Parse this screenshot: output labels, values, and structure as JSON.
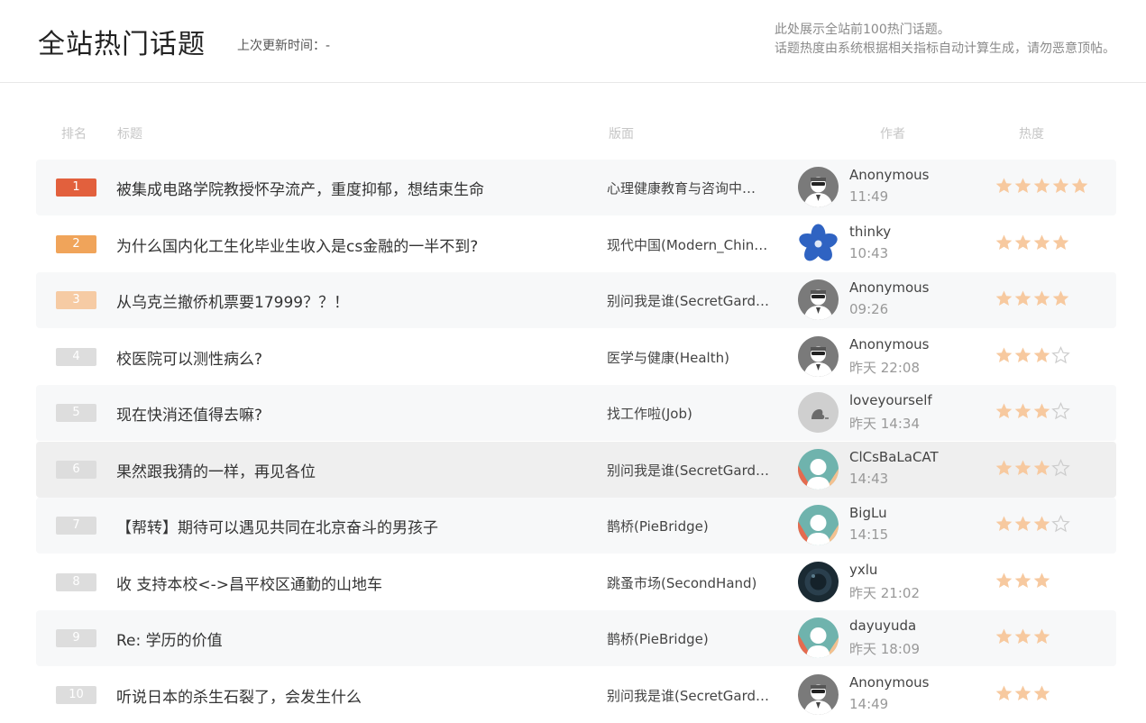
{
  "header": {
    "title": "全站热门话题",
    "updated": "上次更新时间：-",
    "notice_line1": "此处展示全站前100热门话题。",
    "notice_line2": "话题热度由系统根据相关指标自动计算生成，请勿恶意顶帖。"
  },
  "columns": {
    "rank": "排名",
    "title": "标题",
    "board": "版面",
    "author": "作者",
    "heat": "热度"
  },
  "colors": {
    "rank1": "#e2603d",
    "rank2": "#f0a45a",
    "rank3": "#f6cba4",
    "rank_default": "#dddddd",
    "star_filled": "#f7c99f",
    "star_empty": "#cccccc"
  },
  "topics": [
    {
      "rank": "1",
      "title": "被集成电路学院教授怀孕流产，重度抑郁，想结束生命",
      "board": "心理健康教育与咨询中…",
      "author": "Anonymous",
      "time": "11:49",
      "stars": 5,
      "max_stars": 5,
      "avatar": "anonymous-avatar"
    },
    {
      "rank": "2",
      "title": "为什么国内化工生化毕业生收入是cs金融的一半不到?",
      "board": "现代中国(Modern_Chin…",
      "author": "thinky",
      "time": "10:43",
      "stars": 4,
      "max_stars": 4,
      "avatar": "blue-flower-avatar"
    },
    {
      "rank": "3",
      "title": "从乌克兰撤侨机票要17999？？！",
      "board": "别问我是谁(SecretGard…",
      "author": "Anonymous",
      "time": "09:26",
      "stars": 4,
      "max_stars": 4,
      "avatar": "anonymous-avatar"
    },
    {
      "rank": "4",
      "title": "校医院可以测性病么?",
      "board": "医学与健康(Health)",
      "author": "Anonymous",
      "time": "昨天 22:08",
      "stars": 3,
      "max_stars": 4,
      "avatar": "anonymous-avatar"
    },
    {
      "rank": "5",
      "title": "现在快消还值得去嘛?",
      "board": "找工作啦(Job)",
      "author": "loveyourself",
      "time": "昨天 14:34",
      "stars": 3,
      "max_stars": 4,
      "avatar": "grey-avatar"
    },
    {
      "rank": "6",
      "title": "果然跟我猜的一样，再见各位",
      "board": "别问我是谁(SecretGard…",
      "author": "ClCsBaLaCAT",
      "time": "14:43",
      "stars": 3,
      "max_stars": 4,
      "avatar": "default-person-avatar"
    },
    {
      "rank": "7",
      "title": "【帮转】期待可以遇见共同在北京奋斗的男孩子",
      "board": "鹊桥(PieBridge)",
      "author": "BigLu",
      "time": "14:15",
      "stars": 3,
      "max_stars": 4,
      "avatar": "default-person-avatar"
    },
    {
      "rank": "8",
      "title": "收 支持本校<->昌平校区通勤的山地车",
      "board": "跳蚤市场(SecondHand)",
      "author": "yxlu",
      "time": "昨天 21:02",
      "stars": 3,
      "max_stars": 3,
      "avatar": "dark-photo-avatar"
    },
    {
      "rank": "9",
      "title": "Re: 学历的价值",
      "board": "鹊桥(PieBridge)",
      "author": "dayuyuda",
      "time": "昨天 18:09",
      "stars": 3,
      "max_stars": 3,
      "avatar": "default-person-avatar"
    },
    {
      "rank": "10",
      "title": "听说日本的杀生石裂了，会发生什么",
      "board": "别问我是谁(SecretGard…",
      "author": "Anonymous",
      "time": "14:49",
      "stars": 3,
      "max_stars": 3,
      "avatar": "anonymous-avatar"
    }
  ]
}
